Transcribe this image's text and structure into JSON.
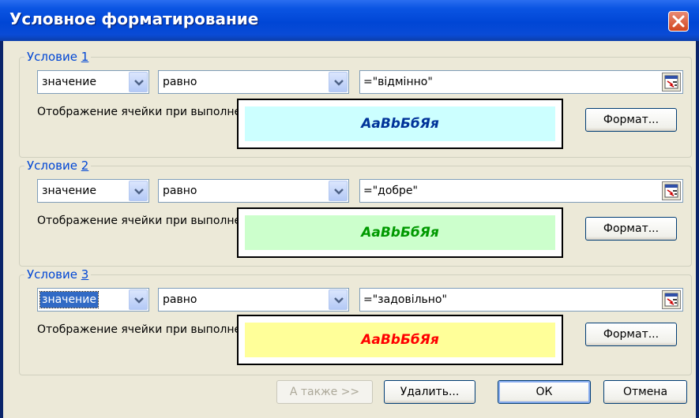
{
  "window": {
    "title": "Условное форматирование",
    "close_icon": "close-icon"
  },
  "conditions": [
    {
      "legend_prefix": "Условие ",
      "legend_number": "1",
      "type_value": "значение",
      "operator_value": "равно",
      "formula_value": "=\"відмінно\"",
      "caption": "Отображение ячейки при выполнении условия:",
      "sample_text": "АаВbБбЯя",
      "sample_color": "#003399",
      "sample_background": "#ccffff",
      "format_label": "Формат..."
    },
    {
      "legend_prefix": "Условие ",
      "legend_number": "2",
      "type_value": "значение",
      "operator_value": "равно",
      "formula_value": "=\"добре\"",
      "caption": "Отображение ячейки при выполнении условия:",
      "sample_text": "АаВbБбЯя",
      "sample_color": "#009900",
      "sample_background": "#ccffcc",
      "format_label": "Формат..."
    },
    {
      "legend_prefix": "Условие ",
      "legend_number": "3",
      "type_value": "значение",
      "operator_value": "равно",
      "formula_value": "=\"задовільно\"",
      "caption": "Отображение ячейки при выполнении условия:",
      "sample_text": "АаВbБбЯя",
      "sample_color": "#ff0000",
      "sample_background": "#ffff99",
      "format_label": "Формат..."
    }
  ],
  "buttons": {
    "also": "А также >>",
    "delete": "Удалить...",
    "ok": "ОК",
    "cancel": "Отмена"
  }
}
